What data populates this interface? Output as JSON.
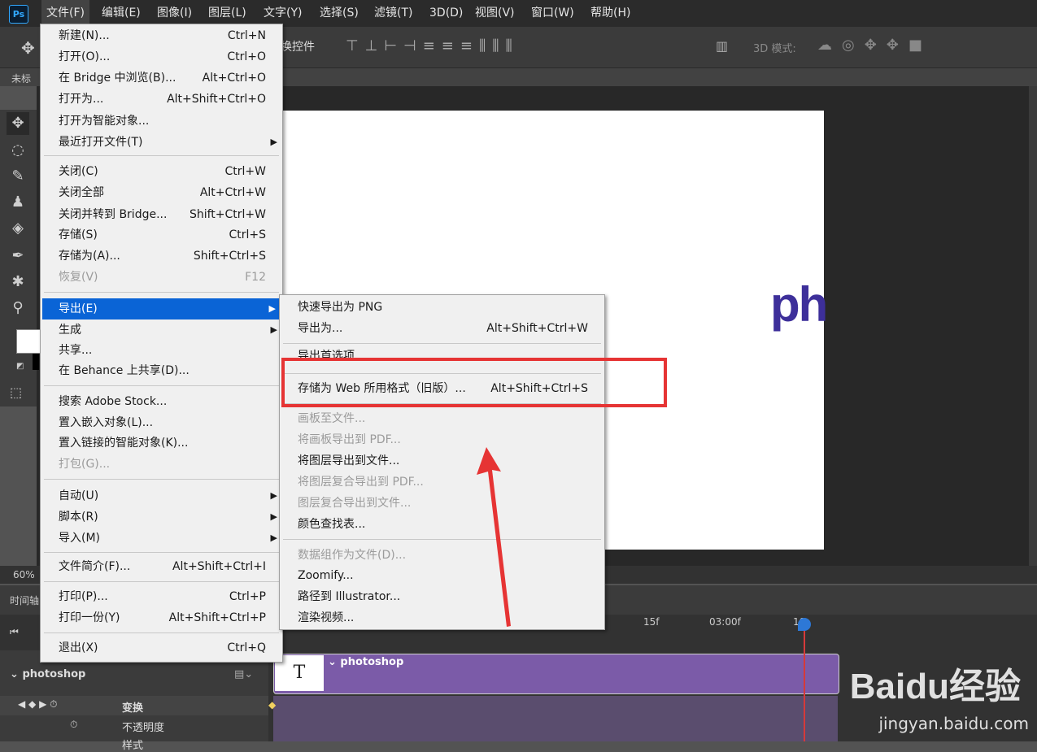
{
  "app": {
    "logo": "Ps"
  },
  "menubar": [
    "文件(F)",
    "编辑(E)",
    "图像(I)",
    "图层(L)",
    "文字(Y)",
    "选择(S)",
    "滤镜(T)",
    "3D(D)",
    "视图(V)",
    "窗口(W)",
    "帮助(H)"
  ],
  "optionsbar": {
    "transform_controls": "换控件",
    "mode_3d": "3D 模式:"
  },
  "tab": {
    "title": "未标"
  },
  "canvas": {
    "text": "ph"
  },
  "status": {
    "zoom": "60%"
  },
  "timeline": {
    "panel_label": "时间轴",
    "ticks": [
      "15f",
      "03:00f",
      "10"
    ],
    "layer": "photoshop",
    "track_label": "photoshop",
    "t_icon": "T",
    "rows": [
      "变换",
      "不透明度",
      "样式"
    ]
  },
  "file_menu": [
    {
      "label": "新建(N)...",
      "shortcut": "Ctrl+N"
    },
    {
      "label": "打开(O)...",
      "shortcut": "Ctrl+O"
    },
    {
      "label": "在 Bridge 中浏览(B)...",
      "shortcut": "Alt+Ctrl+O"
    },
    {
      "label": "打开为...",
      "shortcut": "Alt+Shift+Ctrl+O"
    },
    {
      "label": "打开为智能对象...",
      "shortcut": ""
    },
    {
      "label": "最近打开文件(T)",
      "shortcut": ""
    },
    {
      "label": "关闭(C)",
      "shortcut": "Ctrl+W"
    },
    {
      "label": "关闭全部",
      "shortcut": "Alt+Ctrl+W"
    },
    {
      "label": "关闭并转到 Bridge...",
      "shortcut": "Shift+Ctrl+W"
    },
    {
      "label": "存储(S)",
      "shortcut": "Ctrl+S"
    },
    {
      "label": "存储为(A)...",
      "shortcut": "Shift+Ctrl+S"
    },
    {
      "label": "恢复(V)",
      "shortcut": "F12"
    },
    {
      "label": "导出(E)",
      "shortcut": ""
    },
    {
      "label": "生成",
      "shortcut": ""
    },
    {
      "label": "共享...",
      "shortcut": ""
    },
    {
      "label": "在 Behance 上共享(D)...",
      "shortcut": ""
    },
    {
      "label": "搜索 Adobe Stock...",
      "shortcut": ""
    },
    {
      "label": "置入嵌入对象(L)...",
      "shortcut": ""
    },
    {
      "label": "置入链接的智能对象(K)...",
      "shortcut": ""
    },
    {
      "label": "打包(G)...",
      "shortcut": ""
    },
    {
      "label": "自动(U)",
      "shortcut": ""
    },
    {
      "label": "脚本(R)",
      "shortcut": ""
    },
    {
      "label": "导入(M)",
      "shortcut": ""
    },
    {
      "label": "文件简介(F)...",
      "shortcut": "Alt+Shift+Ctrl+I"
    },
    {
      "label": "打印(P)...",
      "shortcut": "Ctrl+P"
    },
    {
      "label": "打印一份(Y)",
      "shortcut": "Alt+Shift+Ctrl+P"
    },
    {
      "label": "退出(X)",
      "shortcut": "Ctrl+Q"
    }
  ],
  "export_menu": [
    {
      "label": "快速导出为 PNG",
      "shortcut": ""
    },
    {
      "label": "导出为...",
      "shortcut": "Alt+Shift+Ctrl+W"
    },
    {
      "label": "导出首选项...",
      "shortcut": ""
    },
    {
      "label": "存储为 Web 所用格式（旧版）...",
      "shortcut": "Alt+Shift+Ctrl+S"
    },
    {
      "label": "画板至文件...",
      "shortcut": ""
    },
    {
      "label": "将画板导出到 PDF...",
      "shortcut": ""
    },
    {
      "label": "将图层导出到文件...",
      "shortcut": ""
    },
    {
      "label": "将图层复合导出到 PDF...",
      "shortcut": ""
    },
    {
      "label": "图层复合导出到文件...",
      "shortcut": ""
    },
    {
      "label": "颜色查找表...",
      "shortcut": ""
    },
    {
      "label": "数据组作为文件(D)...",
      "shortcut": ""
    },
    {
      "label": "Zoomify...",
      "shortcut": ""
    },
    {
      "label": "路径到 Illustrator...",
      "shortcut": ""
    },
    {
      "label": "渲染视频...",
      "shortcut": ""
    }
  ],
  "watermark": {
    "brand": "Baidu经验",
    "url": "jingyan.baidu.com"
  },
  "colors": {
    "highlight": "#0a64d6",
    "red_box": "#e63434",
    "track": "#7b5ba8"
  }
}
